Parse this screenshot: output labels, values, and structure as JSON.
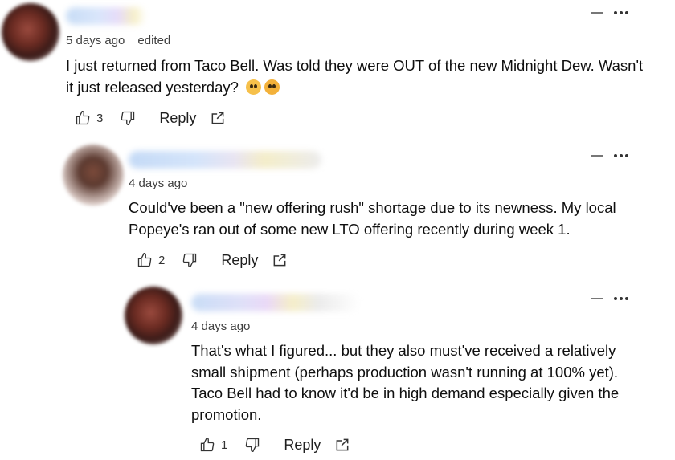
{
  "comments": [
    {
      "time": "5 days ago",
      "edited": "edited",
      "text_line1": "I just returned from Taco Bell. Was told they were OUT of the new Midnight Dew. Wasn't",
      "text_line2": "it just released yesterday?",
      "emojis": [
        "flushed-face-emoji",
        "tongue-out-emoji"
      ],
      "likes": "3",
      "reply_label": "Reply"
    },
    {
      "time": "4 days ago",
      "text_line1": "Could've been a \"new offering rush\" shortage due to its newness. My local",
      "text_line2": "Popeye's ran out of some new LTO offering recently during week 1.",
      "likes": "2",
      "reply_label": "Reply"
    },
    {
      "time": "4 days ago",
      "text_line1": "That's what I figured... but they also must've received a relatively",
      "text_line2": "small shipment (perhaps production wasn't running at 100% yet).",
      "text_line3": "Taco Bell had to know it'd be in high demand especially given the",
      "text_line4": "promotion.",
      "likes": "1",
      "reply_label": "Reply"
    }
  ],
  "colors": {
    "text": "#0f0f0f",
    "meta": "#404040",
    "icon": "#333333"
  }
}
